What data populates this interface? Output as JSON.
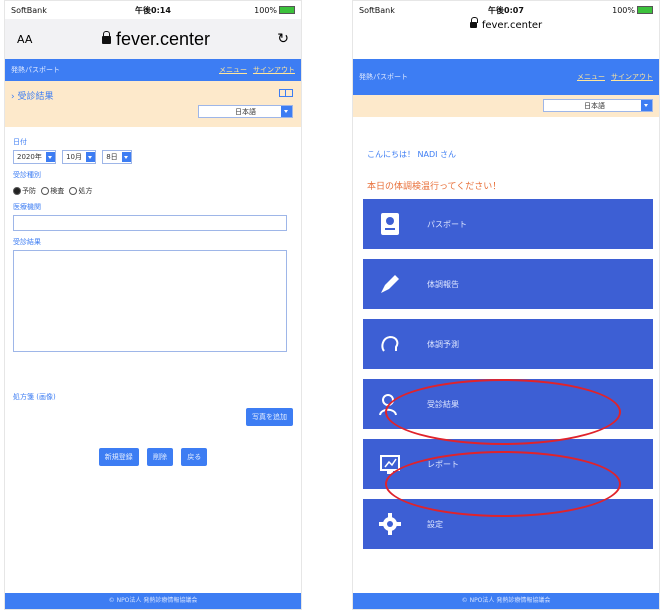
{
  "left": {
    "status": {
      "carrier": "SoftBank",
      "time": "午後0:14",
      "battery": "100%"
    },
    "browser": {
      "aa": "AA",
      "url": "fever.center",
      "reload": "↻"
    },
    "appbar": {
      "title": "発熱パスポート",
      "menu": "メニュー",
      "signout": "サインアウト"
    },
    "section": {
      "title": "› 受診結果",
      "language": "日本語"
    },
    "form": {
      "date_label": "日付",
      "year": "2020年",
      "month": "10月",
      "day": "8日",
      "type_label": "受診種別",
      "opt_prevent": "予防",
      "opt_exam": "検査",
      "opt_rx": "処方",
      "institution_label": "医療機関",
      "result_label": "受診結果",
      "rx_label": "処方箋 (画像)",
      "add_photo": "写真を追加",
      "register": "新規登録",
      "delete": "削除",
      "back": "戻る"
    },
    "footer": "© NPO法人 発熱診療情報協議会"
  },
  "right": {
    "status": {
      "carrier": "SoftBank",
      "time": "午後0:07",
      "battery": "100%"
    },
    "browser": {
      "url": "fever.center"
    },
    "appbar": {
      "title": "発熱パスポート",
      "menu": "メニュー",
      "signout": "サインアウト"
    },
    "language": "日本語",
    "greeting": "こんにちは！ NADI さん",
    "reminder": "本日の体調検温行ってください！",
    "menu": [
      {
        "label": "パスポート",
        "icon": "passport-icon"
      },
      {
        "label": "体調報告",
        "icon": "pen-icon"
      },
      {
        "label": "体調予測",
        "icon": "head-icon"
      },
      {
        "label": "受診結果",
        "icon": "doctor-icon"
      },
      {
        "label": "レポート",
        "icon": "report-icon"
      },
      {
        "label": "設定",
        "icon": "gear-icon"
      }
    ],
    "footer": "© NPO法人 発熱診療情報協議会"
  },
  "colors": {
    "accent": "#3d7df3",
    "tile": "#3d5fd4",
    "section": "#fde9cb",
    "highlight": "#e0232b"
  }
}
